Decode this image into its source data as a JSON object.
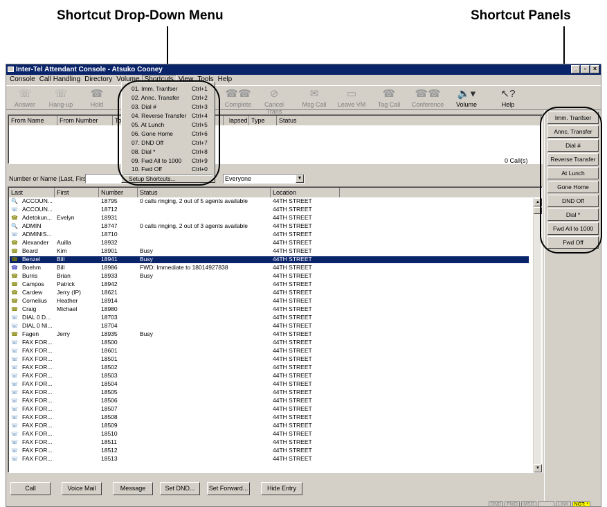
{
  "callouts": {
    "left": "Shortcut Drop-Down Menu",
    "right": "Shortcut Panels"
  },
  "window": {
    "title": "Inter-Tel Attendant Console - Atsuko Cooney"
  },
  "menu": [
    "Console",
    "Call Handling",
    "Directory",
    "Volume",
    "Shortcuts",
    "View",
    "Tools",
    "Help"
  ],
  "toolbar": [
    {
      "label": "Answer",
      "icon": "answer-icon"
    },
    {
      "label": "Hang-up",
      "icon": "hangup-icon"
    },
    {
      "label": "Hold",
      "icon": "hold-icon"
    },
    {
      "label": "Complete",
      "icon": "complete-icon"
    },
    {
      "label": "Cancel Trans",
      "icon": "cancel-transfer-icon"
    },
    {
      "label": "Msg Call",
      "icon": "msg-call-icon"
    },
    {
      "label": "Leave VM",
      "icon": "leave-vm-icon"
    },
    {
      "label": "Tag Call",
      "icon": "tag-call-icon"
    },
    {
      "label": "Conference",
      "icon": "conference-icon"
    },
    {
      "label": "Volume",
      "icon": "volume-icon"
    },
    {
      "label": "Help",
      "icon": "help-icon"
    }
  ],
  "calls": {
    "headers": [
      "From Name",
      "From Number",
      "To",
      "lapsed",
      "Type",
      "Status"
    ],
    "count": "0 Call(s)"
  },
  "dropdown": {
    "items": [
      {
        "label": "01. Imm. Tranfser",
        "shortcut": "Ctrl+1"
      },
      {
        "label": "02. Annc. Transfer",
        "shortcut": "Ctrl+2"
      },
      {
        "label": "03. Dial #",
        "shortcut": "Ctrl+3"
      },
      {
        "label": "04. Reverse Transfer",
        "shortcut": "Ctrl+4"
      },
      {
        "label": "05. At Lunch",
        "shortcut": "Ctrl+5"
      },
      {
        "label": "06. Gone Home",
        "shortcut": "Ctrl+6"
      },
      {
        "label": "07. DND Off",
        "shortcut": "Ctrl+7"
      },
      {
        "label": "08. Dial *",
        "shortcut": "Ctrl+8"
      },
      {
        "label": "09. Fwd All to 1000",
        "shortcut": "Ctrl+9"
      },
      {
        "label": "10. Fwd Off",
        "shortcut": "Ctrl+0"
      }
    ],
    "setup": "Setup Shortcuts..."
  },
  "search": {
    "label": "Number or Name (Last, First):",
    "filter": "Everyone"
  },
  "directory": {
    "headers": [
      "Last",
      "First",
      "Number",
      "Status",
      "Location"
    ],
    "rows": [
      {
        "last": "ACCOUN...",
        "first": "",
        "number": "18795",
        "status": "0 calls ringing, 2 out of 5 agents available",
        "location": "44TH STREET",
        "icon": "search"
      },
      {
        "last": "ACCOUN...",
        "first": "",
        "number": "18712",
        "status": "",
        "location": "44TH STREET",
        "icon": "ext"
      },
      {
        "last": "Adetokun...",
        "first": "Evelyn",
        "number": "18931",
        "status": "",
        "location": "44TH STREET",
        "icon": "phone"
      },
      {
        "last": "ADMIN",
        "first": "",
        "number": "18747",
        "status": "0 calls ringing, 2 out of 3 agents available",
        "location": "44TH STREET",
        "icon": "search"
      },
      {
        "last": "ADMINIS...",
        "first": "",
        "number": "18710",
        "status": "",
        "location": "44TH STREET",
        "icon": "ext"
      },
      {
        "last": "Alexander",
        "first": "Auilla",
        "number": "18932",
        "status": "",
        "location": "44TH STREET",
        "icon": "phone"
      },
      {
        "last": "Beard",
        "first": "Kim",
        "number": "18901",
        "status": "Busy",
        "location": "44TH STREET",
        "icon": "busy"
      },
      {
        "last": "Benzel",
        "first": "Bill",
        "number": "18941",
        "status": "Busy",
        "location": "44TH STREET",
        "icon": "busy",
        "selected": true
      },
      {
        "last": "Boehm",
        "first": "Bill",
        "number": "18986",
        "status": "FWD: Immediate to 18014927838",
        "location": "44TH STREET",
        "icon": "fwd"
      },
      {
        "last": "Burris",
        "first": "Brian",
        "number": "18933",
        "status": "Busy",
        "location": "44TH STREET",
        "icon": "busy"
      },
      {
        "last": "Campos",
        "first": "Patrick",
        "number": "18942",
        "status": "",
        "location": "44TH STREET",
        "icon": "phone"
      },
      {
        "last": "Cardew",
        "first": "Jerry (IP)",
        "number": "18621",
        "status": "",
        "location": "44TH STREET",
        "icon": "phone"
      },
      {
        "last": "Cornelius",
        "first": "Heather",
        "number": "18914",
        "status": "",
        "location": "44TH STREET",
        "icon": "phone"
      },
      {
        "last": "Craig",
        "first": "Michael",
        "number": "18980",
        "status": "",
        "location": "44TH STREET",
        "icon": "phone"
      },
      {
        "last": "DIAL 0 D...",
        "first": "",
        "number": "18703",
        "status": "",
        "location": "44TH STREET",
        "icon": "ext"
      },
      {
        "last": "DIAL 0 NI...",
        "first": "",
        "number": "18704",
        "status": "",
        "location": "44TH STREET",
        "icon": "ext"
      },
      {
        "last": "Fagen",
        "first": "Jerry",
        "number": "18935",
        "status": "Busy",
        "location": "44TH STREET",
        "icon": "busy"
      },
      {
        "last": "FAX FOR...",
        "first": "",
        "number": "18500",
        "status": "",
        "location": "44TH STREET",
        "icon": "ext"
      },
      {
        "last": "FAX FOR...",
        "first": "",
        "number": "18601",
        "status": "",
        "location": "44TH STREET",
        "icon": "ext"
      },
      {
        "last": "FAX FOR...",
        "first": "",
        "number": "18501",
        "status": "",
        "location": "44TH STREET",
        "icon": "ext"
      },
      {
        "last": "FAX FOR...",
        "first": "",
        "number": "18502",
        "status": "",
        "location": "44TH STREET",
        "icon": "ext"
      },
      {
        "last": "FAX FOR...",
        "first": "",
        "number": "18503",
        "status": "",
        "location": "44TH STREET",
        "icon": "ext"
      },
      {
        "last": "FAX FOR...",
        "first": "",
        "number": "18504",
        "status": "",
        "location": "44TH STREET",
        "icon": "ext"
      },
      {
        "last": "FAX FOR...",
        "first": "",
        "number": "18505",
        "status": "",
        "location": "44TH STREET",
        "icon": "ext"
      },
      {
        "last": "FAX FOR...",
        "first": "",
        "number": "18506",
        "status": "",
        "location": "44TH STREET",
        "icon": "ext"
      },
      {
        "last": "FAX FOR...",
        "first": "",
        "number": "18507",
        "status": "",
        "location": "44TH STREET",
        "icon": "ext"
      },
      {
        "last": "FAX FOR...",
        "first": "",
        "number": "18508",
        "status": "",
        "location": "44TH STREET",
        "icon": "ext"
      },
      {
        "last": "FAX FOR...",
        "first": "",
        "number": "18509",
        "status": "",
        "location": "44TH STREET",
        "icon": "ext"
      },
      {
        "last": "FAX FOR...",
        "first": "",
        "number": "18510",
        "status": "",
        "location": "44TH STREET",
        "icon": "ext"
      },
      {
        "last": "FAX FOR...",
        "first": "",
        "number": "18511",
        "status": "",
        "location": "44TH STREET",
        "icon": "ext"
      },
      {
        "last": "FAX FOR...",
        "first": "",
        "number": "18512",
        "status": "",
        "location": "44TH STREET",
        "icon": "ext"
      },
      {
        "last": "FAX FOR...",
        "first": "",
        "number": "18513",
        "status": "",
        "location": "44TH STREET",
        "icon": "ext"
      }
    ]
  },
  "buttons": {
    "call": "Call",
    "voicemail": "Voice Mail",
    "message": "Message",
    "set_dnd": "Set DND...",
    "set_forward": "Set Forward...",
    "hide_entry": "Hide Entry"
  },
  "panels": [
    "Imm. Tranfser",
    "Annc. Transfer",
    "Dial #",
    "Reverse Transfer",
    "At Lunch",
    "Gone Home",
    "DND Off",
    "Dial *",
    "Fwd All to 1000",
    "Fwd Off"
  ],
  "statusbar": [
    "DND",
    "FWD",
    "MSG",
    "",
    "LINK",
    "NGT: *"
  ],
  "colors": {
    "titlebar": "#0a246a",
    "face": "#d4d0c8",
    "selection": "#0a246a",
    "night": "#ffff00"
  }
}
